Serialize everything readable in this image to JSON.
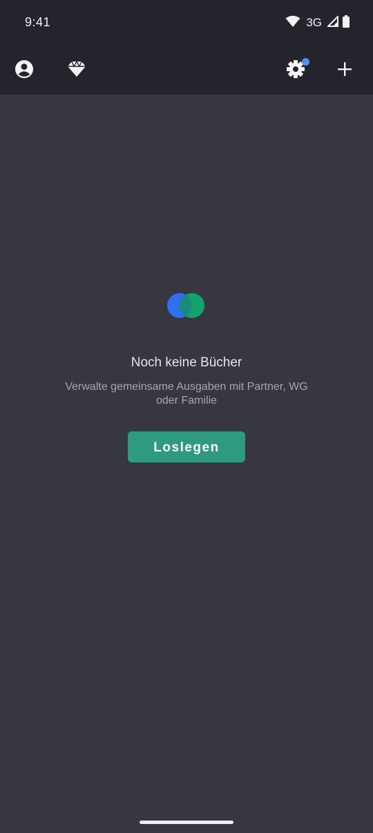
{
  "status_bar": {
    "time": "9:41",
    "network": "3G",
    "icons": [
      "wifi-icon",
      "signal-icon",
      "battery-icon"
    ]
  },
  "app_bar": {
    "left_icons": [
      "profile-icon",
      "diamond-icon"
    ],
    "right_icons": [
      "settings-icon",
      "add-icon"
    ],
    "settings_has_notification": true
  },
  "empty_state": {
    "logo": "overlapping-circles-logo",
    "title": "Noch keine Bücher",
    "subtitle": "Verwalte gemeinsame Ausgaben mit Partner, WG oder Familie",
    "cta_label": "Loslegen"
  },
  "colors": {
    "background": "#363740",
    "app_bar": "#24252c",
    "primary_button": "#2e9a7e",
    "logo_blue": "#2f6ff0",
    "logo_green": "#12a46a",
    "notification_dot": "#5b8de8"
  }
}
